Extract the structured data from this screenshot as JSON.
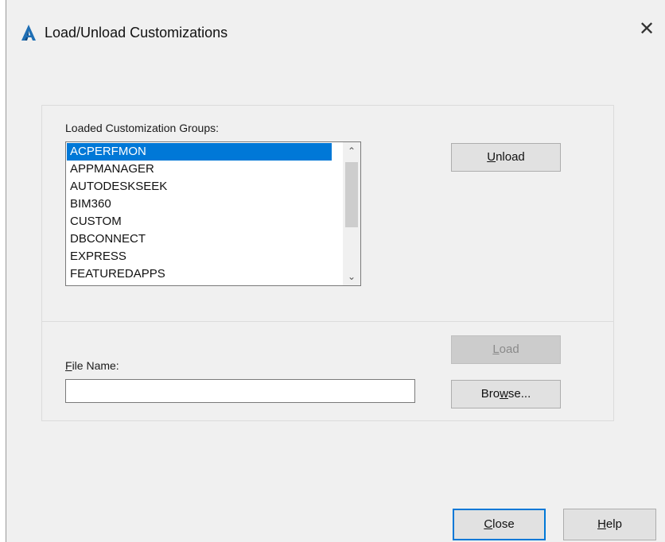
{
  "window": {
    "title": "Load/Unload Customizations",
    "app_icon": "autocad-a-icon",
    "close_glyph": "✕"
  },
  "groups": {
    "label": "Loaded Customization Groups:",
    "items": [
      {
        "label": "ACPERFMON",
        "selected": true
      },
      {
        "label": "APPMANAGER",
        "selected": false
      },
      {
        "label": "AUTODESKSEEK",
        "selected": false
      },
      {
        "label": "BIM360",
        "selected": false
      },
      {
        "label": "CUSTOM",
        "selected": false
      },
      {
        "label": "DBCONNECT",
        "selected": false
      },
      {
        "label": "EXPRESS",
        "selected": false
      },
      {
        "label": "FEATUREDAPPS",
        "selected": false
      }
    ],
    "scroll_up_glyph": "⌃",
    "scroll_down_glyph": "⌄"
  },
  "buttons": {
    "unload_pre": "",
    "unload_mn": "U",
    "unload_post": "nload",
    "load_pre": "",
    "load_mn": "L",
    "load_post": "oad",
    "browse_pre": "Bro",
    "browse_mn": "w",
    "browse_post": "se...",
    "close_pre": "",
    "close_mn": "C",
    "close_post": "lose",
    "help_pre": "",
    "help_mn": "H",
    "help_post": "elp"
  },
  "file": {
    "label_mn": "F",
    "label_post": "ile Name:",
    "value": ""
  },
  "colors": {
    "selection": "#0078d7",
    "dialog_bg": "#f0f0f0",
    "icon_blue": "#1f6fb5"
  }
}
